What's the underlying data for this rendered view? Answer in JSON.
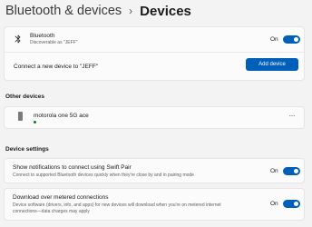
{
  "header": {
    "parent": "Bluetooth & devices",
    "separator": "›",
    "current": "Devices"
  },
  "bluetooth": {
    "title": "Bluetooth",
    "subtitle": "Discoverable as \"JEFF\"",
    "toggle_label": "On",
    "toggle_on": true
  },
  "connect": {
    "label": "Connect a new device to \"JEFF\"",
    "button": "Add device"
  },
  "other_devices": {
    "heading": "Other devices",
    "items": [
      {
        "name": "motorola one 5G ace",
        "more": "···",
        "icon": "phone-icon",
        "status_color": "#107c10"
      }
    ]
  },
  "device_settings": {
    "heading": "Device settings",
    "items": [
      {
        "title": "Show notifications to connect using Swift Pair",
        "subtitle": "Connect to supported Bluetooth devices quickly when they're close by and in pairing mode",
        "toggle_label": "On",
        "toggle_on": true
      },
      {
        "title": "Download over metered connections",
        "subtitle": "Device software (drivers, info, and apps) for new devices will download when you're on metered internet",
        "subtitle2": "connections—data charges may apply",
        "toggle_label": "On",
        "toggle_on": true
      }
    ]
  },
  "colors": {
    "accent": "#005fb8",
    "background": "#f3f3f3",
    "card": "#fbfbfb"
  }
}
